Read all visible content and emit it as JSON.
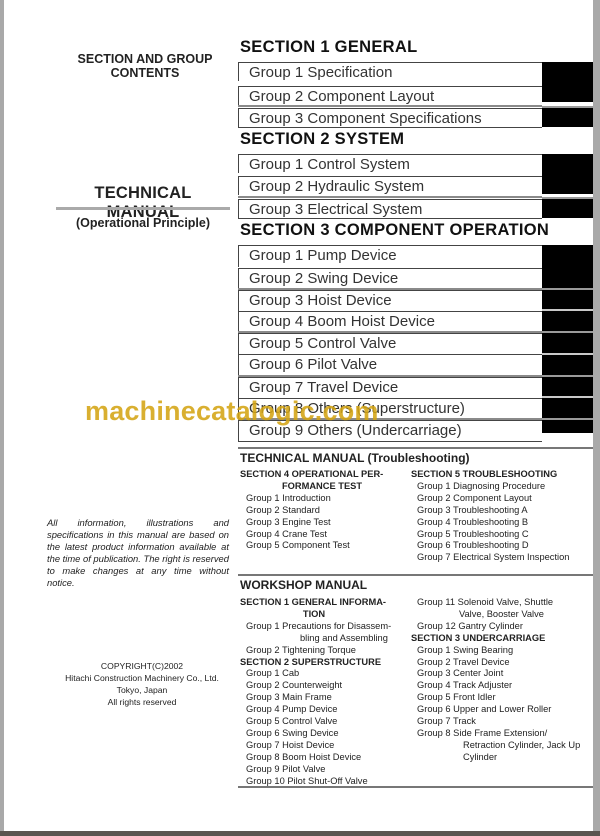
{
  "left": {
    "title_line1": "SECTION AND GROUP",
    "title_line2": "CONTENTS",
    "manual_title": "TECHNICAL MANUAL",
    "manual_subtitle": "(Operational Principle)",
    "disclaimer": "All information, illustrations and specifications in this manual are based on the latest product information available at the time of publication. The right is reserved to make changes at any time without notice.",
    "copyright": [
      "COPYRIGHT(C)2002",
      "Hitachi Construction Machinery Co., Ltd.",
      "Tokyo, Japan",
      "All rights reserved"
    ]
  },
  "toc": {
    "section1": {
      "title": "SECTION 1 GENERAL",
      "groups": [
        "Group 1 Specification",
        "Group 2 Component Layout",
        "Group 3 Component Specifications"
      ]
    },
    "section2": {
      "title": "SECTION 2 SYSTEM",
      "groups": [
        "Group 1 Control System",
        "Group 2 Hydraulic System",
        "Group 3 Electrical System"
      ]
    },
    "section3": {
      "title": "SECTION 3 COMPONENT OPERATION",
      "groups": [
        "Group 1 Pump Device",
        "Group 2 Swing Device",
        "Group 3 Hoist Device",
        "Group 4 Boom Hoist Device",
        "Group 5 Control Valve",
        "Group 6 Pilot Valve",
        "Group 7 Travel Device",
        "Group 8 Others (Superstructure)",
        "Group 9 Others (Undercarriage)"
      ]
    }
  },
  "troubleshooting": {
    "title": "TECHNICAL MANUAL (Troubleshooting)",
    "sec4_title_1": "SECTION 4 OPERATIONAL PER-",
    "sec4_title_2": "FORMANCE TEST",
    "sec4_groups": [
      "Group 1 Introduction",
      "Group 2 Standard",
      "Group 3 Engine Test",
      "Group 4 Crane Test",
      "Group 5 Component Test"
    ],
    "sec5_title": "SECTION 5 TROUBLESHOOTING",
    "sec5_groups": [
      "Group 1 Diagnosing Procedure",
      "Group 2 Component Layout",
      "Group 3 Troubleshooting A",
      "Group 4 Troubleshooting B",
      "Group 5 Troubleshooting C",
      "Group 6 Troubleshooting D",
      "Group 7 Electrical System Inspection"
    ]
  },
  "workshop": {
    "title": "WORKSHOP MANUAL",
    "sec1_title_1": "SECTION 1 GENERAL INFORMA-",
    "sec1_title_2": "TION",
    "sec1_g1_a": "Group 1 Precautions for Disassem-",
    "sec1_g1_b": "bling and Assembling",
    "sec1_g2": "Group 2 Tightening Torque",
    "sec2_title": "SECTION 2 SUPERSTRUCTURE",
    "sec2_groups": [
      "Group 1 Cab",
      "Group 2 Counterweight",
      "Group 3 Main Frame",
      "Group 4 Pump Device",
      "Group 5 Control Valve",
      "Group 6 Swing Device",
      "Group 7 Hoist Device",
      "Group 8 Boom Hoist Device",
      "Group 9 Pilot Valve",
      "Group 10 Pilot Shut-Off Valve"
    ],
    "sec2_g11_a": "Group 11 Solenoid Valve, Shuttle",
    "sec2_g11_b": "Valve, Booster Valve",
    "sec2_g12": "Group 12 Gantry Cylinder",
    "sec3_title": "SECTION 3 UNDERCARRIAGE",
    "sec3_groups": [
      "Group 1 Swing Bearing",
      "Group 2 Travel Device",
      "Group 3 Center Joint",
      "Group 4 Track Adjuster",
      "Group 5 Front Idler",
      "Group 6 Upper and Lower Roller",
      "Group 7 Track"
    ],
    "sec3_g8_a": "Group 8  Side Frame Extension/",
    "sec3_g8_b": "Retraction Cylinder, Jack Up",
    "sec3_g8_c": "Cylinder"
  },
  "watermark": "machinecatalogic.com",
  "colors": {
    "tab": "#000000",
    "watermark": "#d4a514"
  }
}
